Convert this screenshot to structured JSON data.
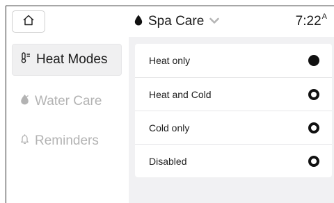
{
  "header": {
    "home_icon": "home-icon",
    "title_icon": "droplet-icon",
    "title": "Spa Care",
    "dropdown_icon": "chevron-down-icon",
    "time": "7:22",
    "time_suffix": "A"
  },
  "sidebar": {
    "items": [
      {
        "label": "Heat Modes",
        "icon": "thermometer-icon",
        "active": true
      },
      {
        "label": "Water Care",
        "icon": "water-drop-icon",
        "active": false
      },
      {
        "label": "Reminders",
        "icon": "bell-icon",
        "active": false
      }
    ]
  },
  "options": [
    {
      "label": "Heat only",
      "selected": true
    },
    {
      "label": "Heat and Cold",
      "selected": false
    },
    {
      "label": "Cold only",
      "selected": false
    },
    {
      "label": "Disabled",
      "selected": false
    }
  ],
  "colors": {
    "accent": "#111111",
    "panel_bg": "#f1f1f3",
    "inactive_text": "#b3b3b3"
  }
}
